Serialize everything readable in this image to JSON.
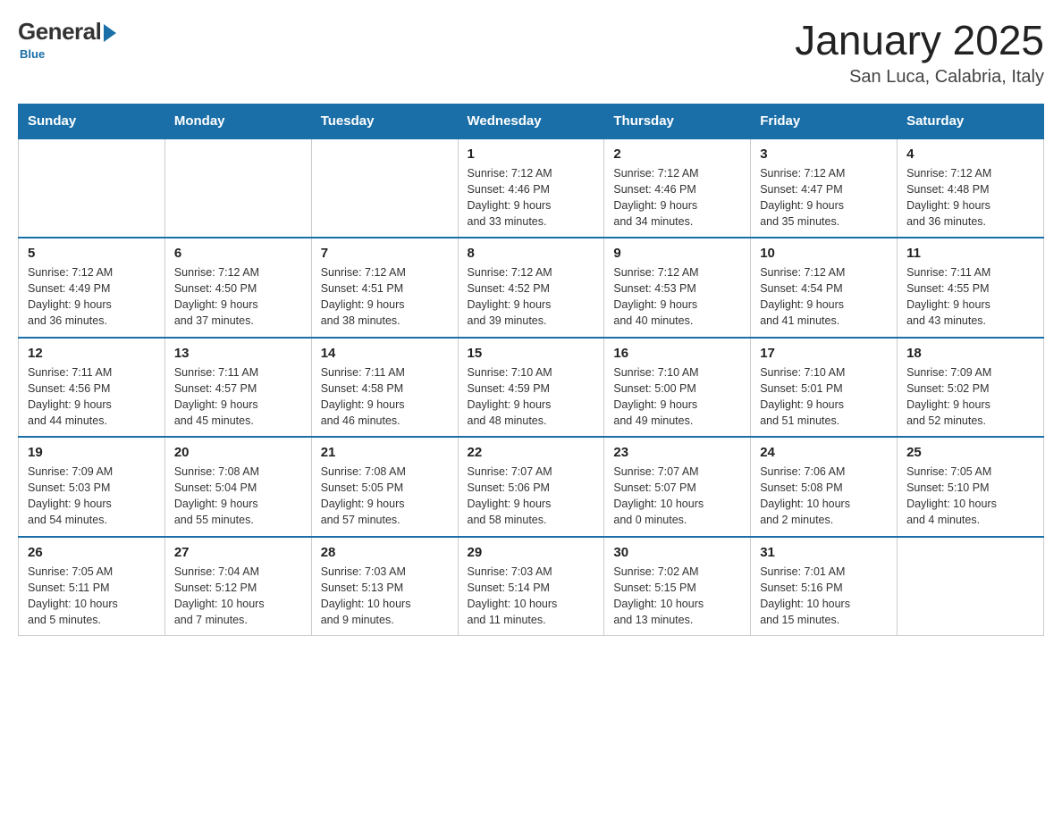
{
  "logo": {
    "general": "General",
    "blue": "Blue",
    "subtitle": "Blue"
  },
  "title": "January 2025",
  "subtitle": "San Luca, Calabria, Italy",
  "days_of_week": [
    "Sunday",
    "Monday",
    "Tuesday",
    "Wednesday",
    "Thursday",
    "Friday",
    "Saturday"
  ],
  "weeks": [
    [
      {
        "day": "",
        "info": ""
      },
      {
        "day": "",
        "info": ""
      },
      {
        "day": "",
        "info": ""
      },
      {
        "day": "1",
        "info": "Sunrise: 7:12 AM\nSunset: 4:46 PM\nDaylight: 9 hours\nand 33 minutes."
      },
      {
        "day": "2",
        "info": "Sunrise: 7:12 AM\nSunset: 4:46 PM\nDaylight: 9 hours\nand 34 minutes."
      },
      {
        "day": "3",
        "info": "Sunrise: 7:12 AM\nSunset: 4:47 PM\nDaylight: 9 hours\nand 35 minutes."
      },
      {
        "day": "4",
        "info": "Sunrise: 7:12 AM\nSunset: 4:48 PM\nDaylight: 9 hours\nand 36 minutes."
      }
    ],
    [
      {
        "day": "5",
        "info": "Sunrise: 7:12 AM\nSunset: 4:49 PM\nDaylight: 9 hours\nand 36 minutes."
      },
      {
        "day": "6",
        "info": "Sunrise: 7:12 AM\nSunset: 4:50 PM\nDaylight: 9 hours\nand 37 minutes."
      },
      {
        "day": "7",
        "info": "Sunrise: 7:12 AM\nSunset: 4:51 PM\nDaylight: 9 hours\nand 38 minutes."
      },
      {
        "day": "8",
        "info": "Sunrise: 7:12 AM\nSunset: 4:52 PM\nDaylight: 9 hours\nand 39 minutes."
      },
      {
        "day": "9",
        "info": "Sunrise: 7:12 AM\nSunset: 4:53 PM\nDaylight: 9 hours\nand 40 minutes."
      },
      {
        "day": "10",
        "info": "Sunrise: 7:12 AM\nSunset: 4:54 PM\nDaylight: 9 hours\nand 41 minutes."
      },
      {
        "day": "11",
        "info": "Sunrise: 7:11 AM\nSunset: 4:55 PM\nDaylight: 9 hours\nand 43 minutes."
      }
    ],
    [
      {
        "day": "12",
        "info": "Sunrise: 7:11 AM\nSunset: 4:56 PM\nDaylight: 9 hours\nand 44 minutes."
      },
      {
        "day": "13",
        "info": "Sunrise: 7:11 AM\nSunset: 4:57 PM\nDaylight: 9 hours\nand 45 minutes."
      },
      {
        "day": "14",
        "info": "Sunrise: 7:11 AM\nSunset: 4:58 PM\nDaylight: 9 hours\nand 46 minutes."
      },
      {
        "day": "15",
        "info": "Sunrise: 7:10 AM\nSunset: 4:59 PM\nDaylight: 9 hours\nand 48 minutes."
      },
      {
        "day": "16",
        "info": "Sunrise: 7:10 AM\nSunset: 5:00 PM\nDaylight: 9 hours\nand 49 minutes."
      },
      {
        "day": "17",
        "info": "Sunrise: 7:10 AM\nSunset: 5:01 PM\nDaylight: 9 hours\nand 51 minutes."
      },
      {
        "day": "18",
        "info": "Sunrise: 7:09 AM\nSunset: 5:02 PM\nDaylight: 9 hours\nand 52 minutes."
      }
    ],
    [
      {
        "day": "19",
        "info": "Sunrise: 7:09 AM\nSunset: 5:03 PM\nDaylight: 9 hours\nand 54 minutes."
      },
      {
        "day": "20",
        "info": "Sunrise: 7:08 AM\nSunset: 5:04 PM\nDaylight: 9 hours\nand 55 minutes."
      },
      {
        "day": "21",
        "info": "Sunrise: 7:08 AM\nSunset: 5:05 PM\nDaylight: 9 hours\nand 57 minutes."
      },
      {
        "day": "22",
        "info": "Sunrise: 7:07 AM\nSunset: 5:06 PM\nDaylight: 9 hours\nand 58 minutes."
      },
      {
        "day": "23",
        "info": "Sunrise: 7:07 AM\nSunset: 5:07 PM\nDaylight: 10 hours\nand 0 minutes."
      },
      {
        "day": "24",
        "info": "Sunrise: 7:06 AM\nSunset: 5:08 PM\nDaylight: 10 hours\nand 2 minutes."
      },
      {
        "day": "25",
        "info": "Sunrise: 7:05 AM\nSunset: 5:10 PM\nDaylight: 10 hours\nand 4 minutes."
      }
    ],
    [
      {
        "day": "26",
        "info": "Sunrise: 7:05 AM\nSunset: 5:11 PM\nDaylight: 10 hours\nand 5 minutes."
      },
      {
        "day": "27",
        "info": "Sunrise: 7:04 AM\nSunset: 5:12 PM\nDaylight: 10 hours\nand 7 minutes."
      },
      {
        "day": "28",
        "info": "Sunrise: 7:03 AM\nSunset: 5:13 PM\nDaylight: 10 hours\nand 9 minutes."
      },
      {
        "day": "29",
        "info": "Sunrise: 7:03 AM\nSunset: 5:14 PM\nDaylight: 10 hours\nand 11 minutes."
      },
      {
        "day": "30",
        "info": "Sunrise: 7:02 AM\nSunset: 5:15 PM\nDaylight: 10 hours\nand 13 minutes."
      },
      {
        "day": "31",
        "info": "Sunrise: 7:01 AM\nSunset: 5:16 PM\nDaylight: 10 hours\nand 15 minutes."
      },
      {
        "day": "",
        "info": ""
      }
    ]
  ]
}
